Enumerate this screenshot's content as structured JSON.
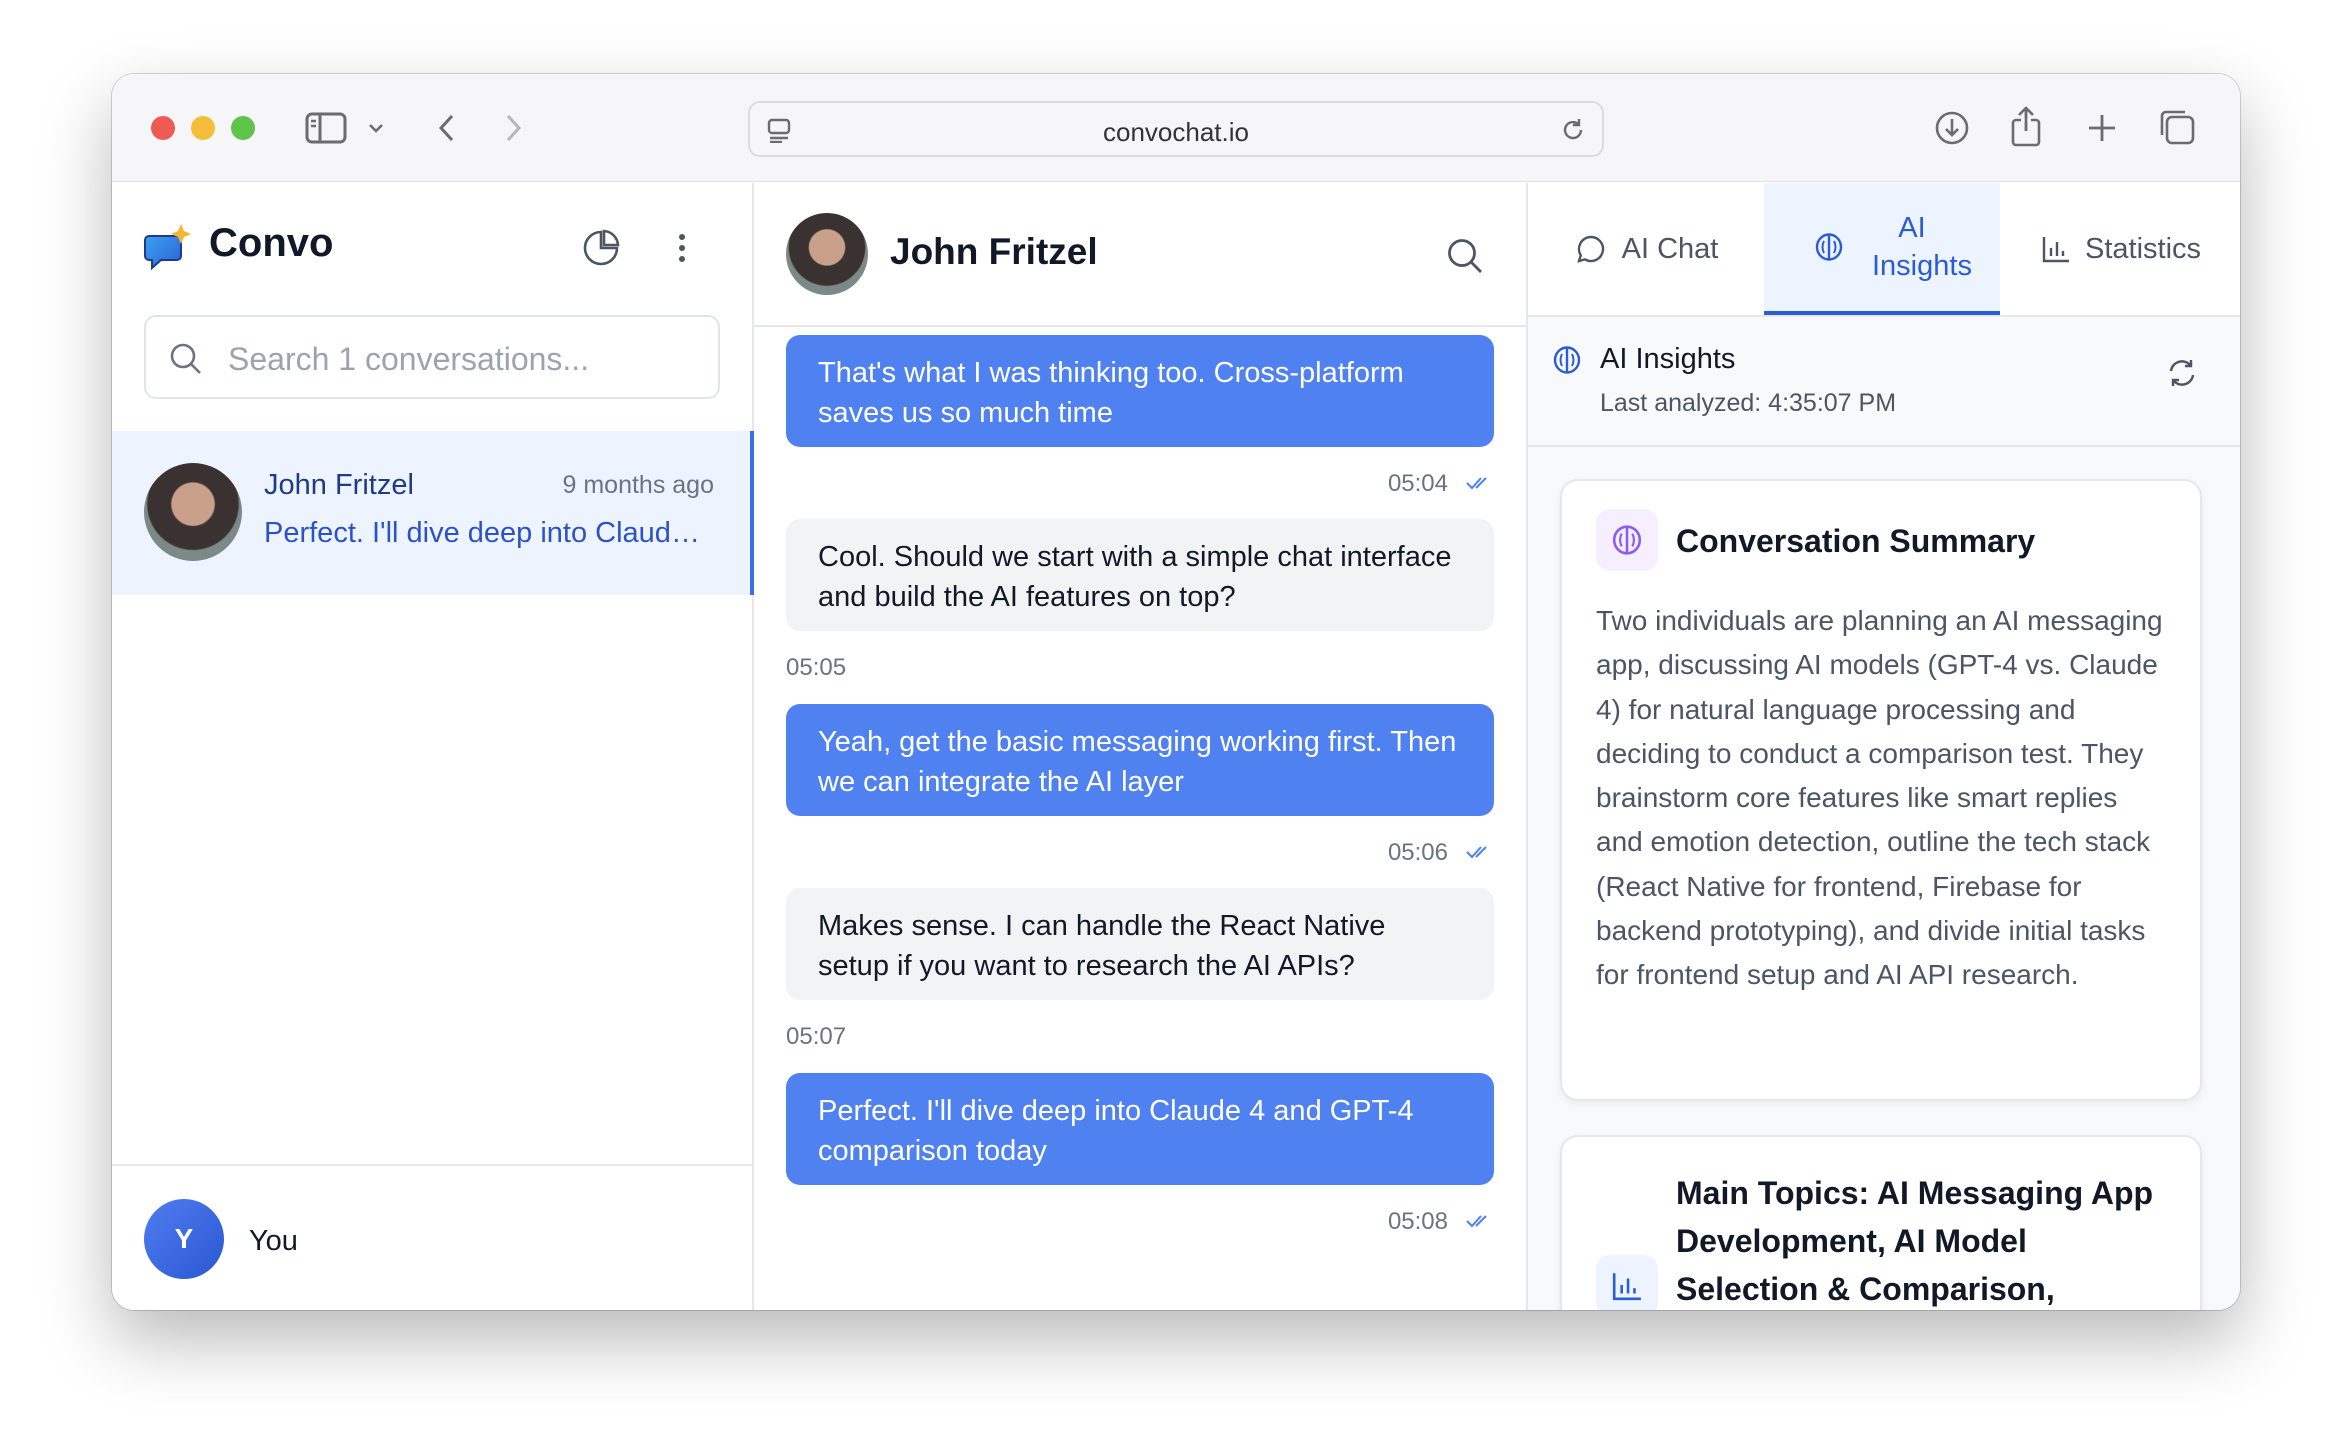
{
  "browser": {
    "url": "convochat.io"
  },
  "sidebar": {
    "app_name": "Convo",
    "search_placeholder": "Search 1 conversations...",
    "conversations": [
      {
        "name": "John Fritzel",
        "time": "9 months ago",
        "preview": "Perfect. I'll dive deep into Claude 4 and GPT-4 comparison today"
      }
    ],
    "user": {
      "initial": "Y",
      "name": "You"
    }
  },
  "chat": {
    "contact_name": "John Fritzel",
    "messages": [
      {
        "sender": "me",
        "text": "That's what I was thinking too. Cross-platform saves us so much time",
        "time": "05:04",
        "read": true
      },
      {
        "sender": "them",
        "text": "Cool. Should we start with a simple chat interface and build the AI features on top?",
        "time": "05:05"
      },
      {
        "sender": "me",
        "text": "Yeah, get the basic messaging working first. Then we can integrate the AI layer",
        "time": "05:06",
        "read": true
      },
      {
        "sender": "them",
        "text": "Makes sense. I can handle the React Native setup if you want to research the AI APIs?",
        "time": "05:07"
      },
      {
        "sender": "me",
        "text": "Perfect. I'll dive deep into Claude 4 and GPT-4 comparison today",
        "time": "05:08",
        "read": true
      }
    ]
  },
  "insights": {
    "tabs": [
      {
        "label": "AI Chat",
        "active": false
      },
      {
        "label": "AI Insights",
        "active": true
      },
      {
        "label": "Statistics",
        "active": false
      }
    ],
    "header_title": "AI Insights",
    "last_analyzed": "Last analyzed: 4:35:07 PM",
    "summary": {
      "title": "Conversation Summary",
      "body": "Two individuals are planning an AI messaging app, discussing AI models (GPT-4 vs. Claude 4) for natural language processing and deciding to conduct a comparison test. They brainstorm core features like smart replies and emotion detection, outline the tech stack (React Native for frontend, Firebase for backend prototyping), and divide initial tasks for frontend setup and AI API research."
    },
    "topics": {
      "title": "Main Topics: AI Messaging App Development, AI Model Selection & Comparison, Feature"
    }
  },
  "colors": {
    "accent": "#2a5cd8",
    "bubble_me": "#4f82f0",
    "bubble_them": "#f2f3f5",
    "active_bg": "#eef4ff"
  }
}
